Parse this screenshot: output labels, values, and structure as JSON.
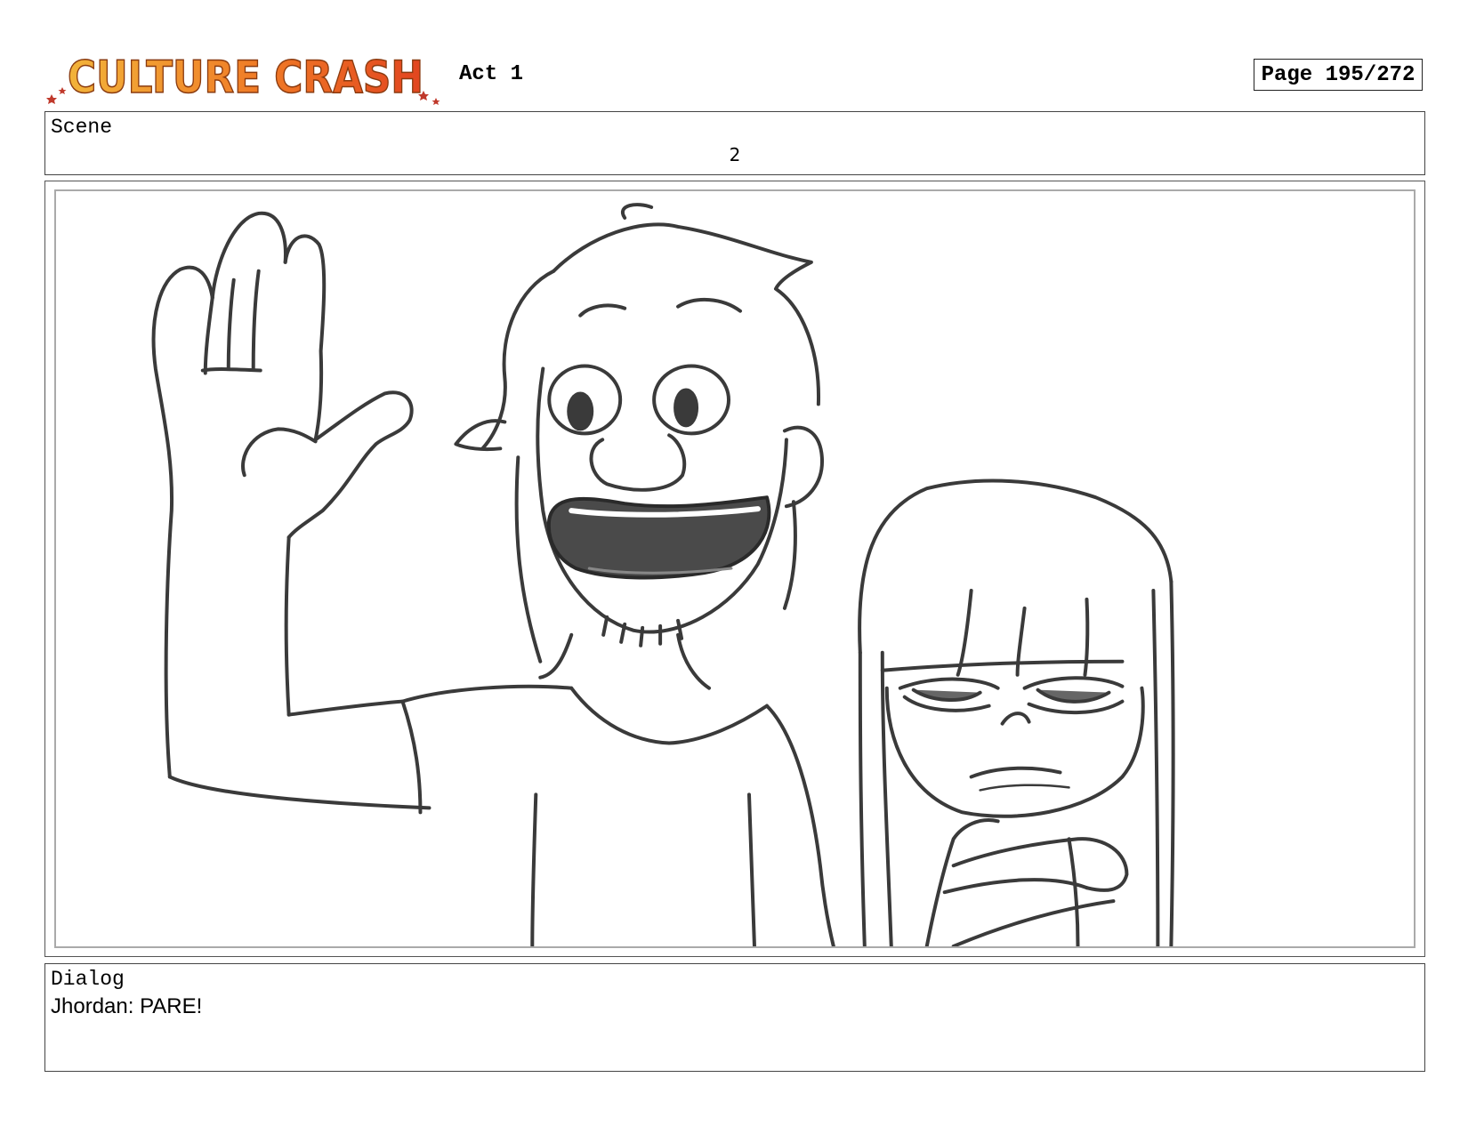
{
  "header": {
    "logo_text": "CULTURE CRASH",
    "act": "Act 1",
    "page": "Page 195/272"
  },
  "scene": {
    "label": "Scene",
    "number": "2"
  },
  "panel": {
    "ink_color": "#3a3a3a",
    "mouth_fill": "#4a4a4a"
  },
  "dialog": {
    "label": "Dialog",
    "text": "Jhordan: PARE!"
  },
  "colors": {
    "logo_gradient_top": "#f2b33a",
    "logo_gradient_bottom": "#e2451f"
  }
}
